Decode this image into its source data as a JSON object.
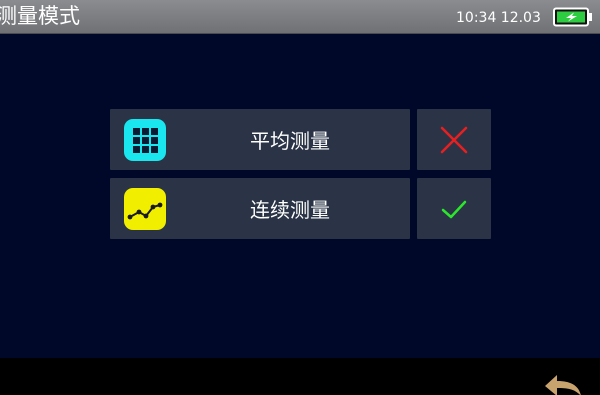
{
  "header": {
    "title": "测量模式",
    "time": "10:34 12.03",
    "battery_icon": "battery-charging-icon",
    "battery_color": "#2ecc40"
  },
  "options": [
    {
      "label": "平均测量",
      "icon": "grid-icon",
      "icon_color": "#19e6ee",
      "status_icon": "cross-icon",
      "status_color": "#e82020"
    },
    {
      "label": "连续测量",
      "icon": "line-chart-icon",
      "icon_color": "#f2ee00",
      "status_icon": "check-icon",
      "status_color": "#2ce62c"
    }
  ],
  "footer": {
    "back_icon": "back-arrow-icon",
    "back_color": "#c8a36e"
  }
}
